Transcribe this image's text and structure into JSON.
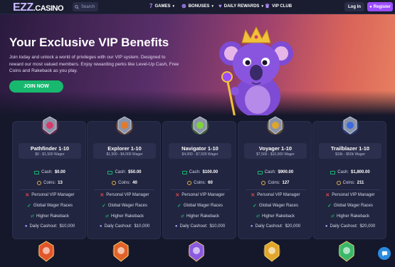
{
  "nav": {
    "logo_ezz": "EZZ",
    "logo_casino": ".CASINO",
    "search_placeholder": "Search",
    "games": "GAMES",
    "bonuses": "BONUSES",
    "daily_rewards": "DAILY REWARDS",
    "vip_club": "VIP CLUB",
    "login": "Log In",
    "register": "Register"
  },
  "hero": {
    "title": "Your Exclusive VIP Benefits",
    "description": "Join today and unlock a world of privileges with our VIP system. Designed to reward our most valued members. Enjoy rewarding perks like Level-Up Cash, Free Coins and Rakeback as you play.",
    "cta": "JOIN NOW"
  },
  "cards": [
    {
      "name": "Pathfinder 1-10",
      "wager": "$0 - $1,500 Wager",
      "cash_label": "Cash:",
      "cash": "$0.00",
      "coins_label": "Coins:",
      "coins": "13",
      "manager": "Personal VIP Manager",
      "races": "Global Wager Races",
      "rakeback": "Higher Rakeback",
      "daily_label": "Daily Cashout:",
      "daily": "$10,000",
      "badge_color": "#d63a6a",
      "manager_ok": false
    },
    {
      "name": "Explorer 1-10",
      "wager": "$1,500 - $4,000 Wager",
      "cash_label": "Cash:",
      "cash": "$50.00",
      "coins_label": "Coins:",
      "coins": "40",
      "manager": "Personal VIP Manager",
      "races": "Global Wager Races",
      "rakeback": "Higher Rakeback",
      "daily_label": "Daily Cashout:",
      "daily": "$10,000",
      "badge_color": "#e27a2a",
      "manager_ok": false
    },
    {
      "name": "Navigator 1-10",
      "wager": "$4,000 - $7,500 Wager",
      "cash_label": "Cash:",
      "cash": "$100.00",
      "coins_label": "Coins:",
      "coins": "60",
      "manager": "Personal VIP Manager",
      "races": "Global Wager Races",
      "rakeback": "Higher Rakeback",
      "daily_label": "Daily Cashout:",
      "daily": "$10,000",
      "badge_color": "#7ed33a",
      "manager_ok": false
    },
    {
      "name": "Voyager 1-10",
      "wager": "$7,500 - $10,000 Wager",
      "cash_label": "Cash:",
      "cash": "$900.00",
      "coins_label": "Coins:",
      "coins": "127",
      "manager": "Personal VIP Manager",
      "races": "Global Wager Races",
      "rakeback": "Higher Rakeback",
      "daily_label": "Daily Cashout:",
      "daily": "$20,000",
      "badge_color": "#e0a62a",
      "manager_ok": false
    },
    {
      "name": "Trailblazer 1-10",
      "wager": "$10k - $50k Wager",
      "cash_label": "Cash:",
      "cash": "$1,800.00",
      "coins_label": "Coins:",
      "coins": "211",
      "manager": "Personal VIP Manager",
      "races": "Global Wager Races",
      "rakeback": "Higher Rakeback",
      "daily_label": "Daily Cashout:",
      "daily": "$20,000",
      "badge_color": "#3a6ae0",
      "manager_ok": false
    }
  ],
  "bottom_badges": [
    {
      "color": "#e2562a"
    },
    {
      "color": "#e2622a"
    },
    {
      "color": "#8a5ae0"
    },
    {
      "color": "#e2a62a"
    },
    {
      "color": "#3ab86a"
    }
  ],
  "colors": {
    "accent": "#9b4dff",
    "green": "#18b86f",
    "background": "#15172b",
    "card": "#222540"
  }
}
